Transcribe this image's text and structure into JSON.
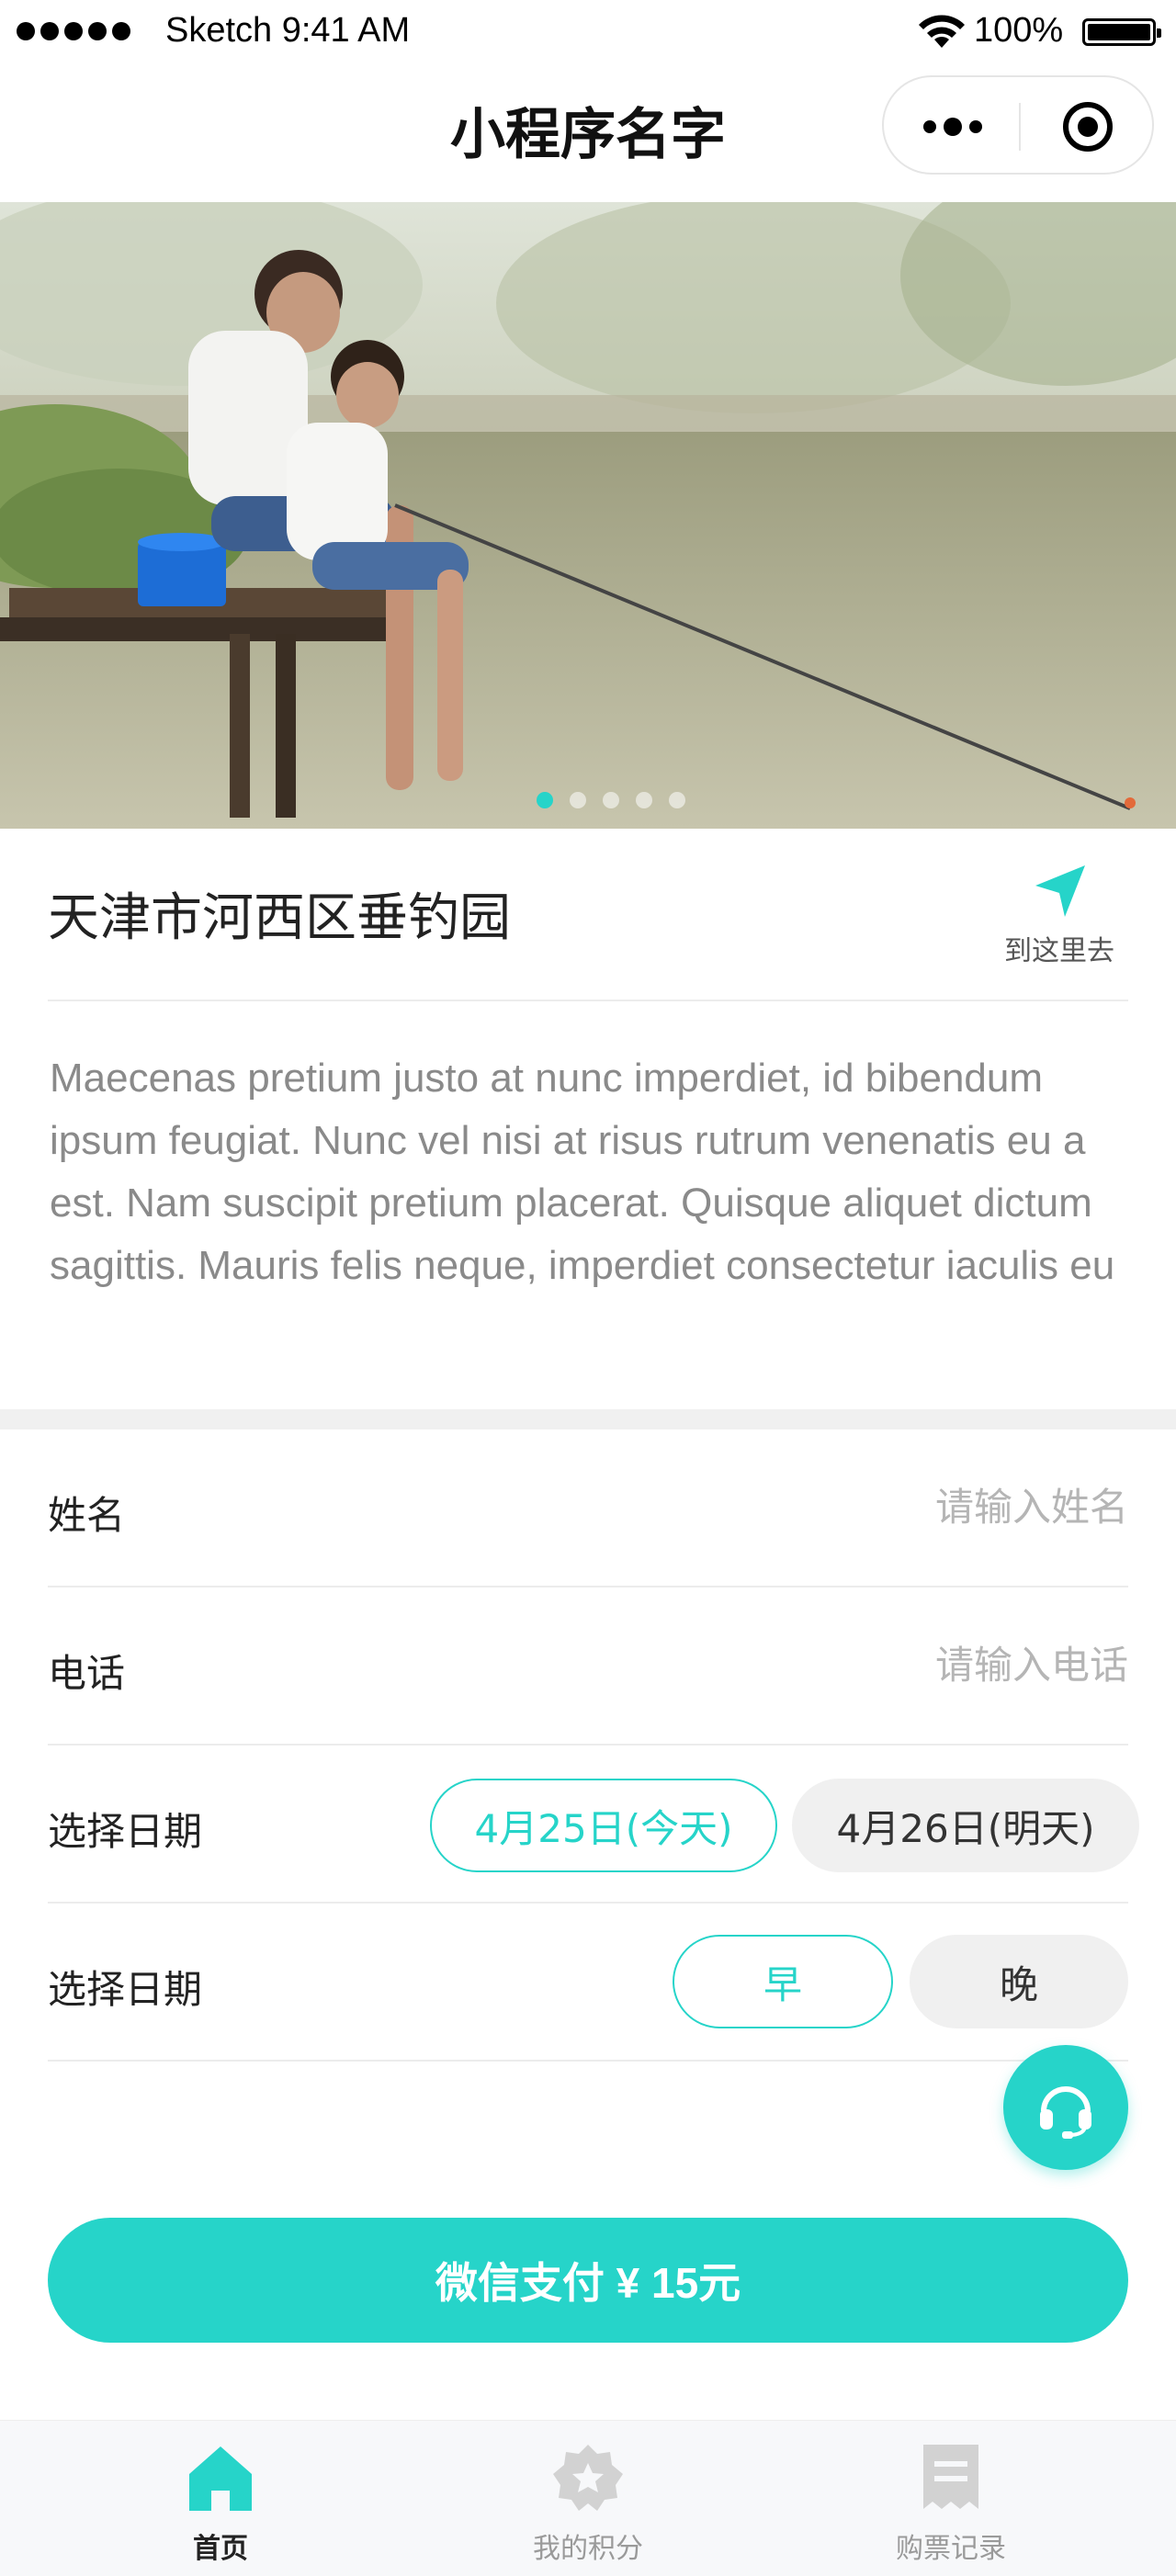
{
  "status_bar": {
    "carrier": "Sketch",
    "time": "9:41 AM",
    "battery": "100%"
  },
  "nav": {
    "title": "小程序名字"
  },
  "banner": {
    "dots_total": 5,
    "active_dot": 1
  },
  "location": {
    "name": "天津市河西区垂钓园",
    "goto_label": "到这里去",
    "description": "Maecenas pretium justo at nunc imperdiet, id bibendum ipsum feugiat. Nunc vel nisi at risus rutrum venenatis eu a est. Nam suscipit pretium placerat. Quisque aliquet dictum sagittis. Mauris felis neque, imperdiet consectetur iaculis eu"
  },
  "form": {
    "name": {
      "label": "姓名",
      "placeholder": "请输入姓名",
      "value": ""
    },
    "phone": {
      "label": "电话",
      "placeholder": "请输入电话",
      "value": ""
    },
    "date": {
      "label": "选择日期",
      "options": [
        "4月25日(今天)",
        "4月26日(明天)"
      ],
      "selected": "4月25日(今天)"
    },
    "session": {
      "label": "选择日期",
      "options": [
        "早",
        "晚"
      ],
      "selected": "早"
    }
  },
  "pay_button": {
    "label": "微信支付 ¥ 15元"
  },
  "tabs": [
    {
      "label": "首页",
      "icon": "home-icon",
      "active": true
    },
    {
      "label": "我的积分",
      "icon": "badge-icon",
      "active": false
    },
    {
      "label": "购票记录",
      "icon": "receipt-icon",
      "active": false
    }
  ],
  "colors": {
    "accent": "#26d4c9",
    "inactive": "#d0d0d0"
  }
}
